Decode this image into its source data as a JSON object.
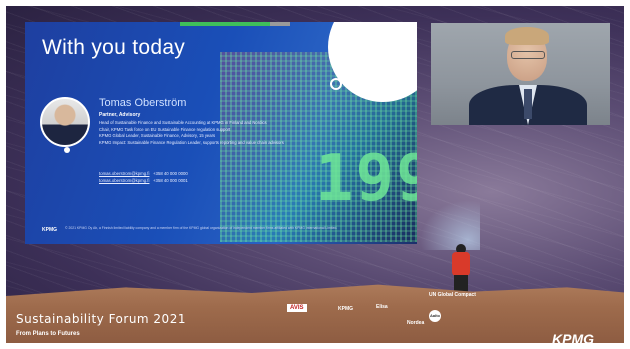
{
  "slide": {
    "title": "With you today",
    "speaker_name": "Tomas Oberström",
    "speaker_role": "Partner, Advisory",
    "bio_lines": [
      "Head of Sustainable Finance and Sustainable Accounting at KPMG in Finland and Nordics",
      "Chair, KPMG Task force on EU Sustainable Finance regulation support",
      "KPMG Global Leader, Sustainable Finance, Advisory, 15 years",
      "KPMG Impact: Sustainable Finance Regulation Leader, supports reporting and value chain advisors"
    ],
    "contact_email": "tomas.oberstrom@kpmg.fi",
    "contact_phone1": "+358 40 000 0000",
    "contact_email2": "tomas.oberstrom@kpmg.fi",
    "contact_phone2": "+358 40 000 0001",
    "logo": "KPMG",
    "footer_text": "© 2021 KPMG Oy Ab, a Finnish limited liability company and a member firm of the KPMG global organization of independent member firms affiliated with KPMG International Limited."
  },
  "event": {
    "title": "Sustainability Forum 2021",
    "subtitle": "From Plans to Futures"
  },
  "sponsors": [
    "AVIS",
    "KPMG",
    "Elisa",
    "Nordea",
    "UN Global Compact",
    "Aalto"
  ],
  "footer_brand": "KPMG",
  "colors": {
    "slide_blue": "#1e3fa0",
    "accent_green": "#3fbf5a",
    "jacket_red": "#d93a2a"
  }
}
